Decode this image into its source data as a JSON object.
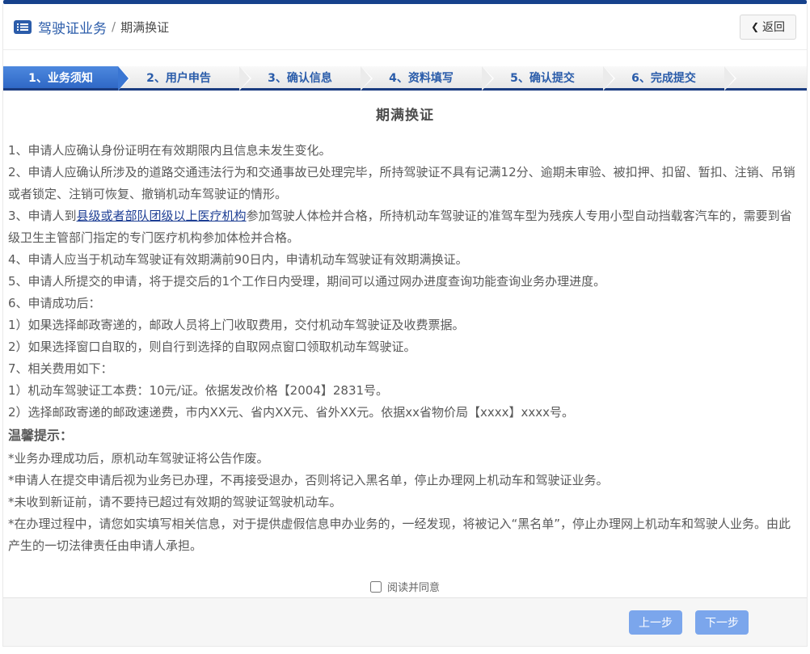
{
  "header": {
    "section_label": "驾驶证业务",
    "separator": "/",
    "current_page": "期满换证",
    "back_icon": "❮",
    "back_label": "返回"
  },
  "steps": [
    {
      "label": "1、业务须知",
      "active": true
    },
    {
      "label": "2、用户申告",
      "active": false
    },
    {
      "label": "3、确认信息",
      "active": false
    },
    {
      "label": "4、资料填写",
      "active": false
    },
    {
      "label": "5、确认提交",
      "active": false
    },
    {
      "label": "6、完成提交",
      "active": false
    }
  ],
  "content": {
    "title": "期满换证",
    "line1": "1、申请人应确认身份证明在有效期限内且信息未发生变化。",
    "line2": "2、申请人应确认所涉及的道路交通违法行为和交通事故已处理完毕，所持驾驶证不具有记满12分、逾期未审验、被扣押、扣留、暂扣、注销、吊销或者锁定、注销可恢复、撤销机动车驾驶证的情形。",
    "line3": {
      "prefix": "3、申请人到",
      "link": "县级或者部队团级以上医疗机构",
      "suffix": "参加驾驶人体检并合格，所持机动车驾驶证的准驾车型为残疾人专用小型自动挡载客汽车的，需要到省级卫生主管部门指定的专门医疗机构参加体检并合格。"
    },
    "line4": "4、申请人应当于机动车驾驶证有效期满前90日内，申请机动车驾驶证有效期满换证。",
    "line5": "5、申请人所提交的申请，将于提交后的1个工作日内受理，期间可以通过网办进度查询功能查询业务办理进度。",
    "line6": "6、申请成功后：",
    "line6_1": "1）如果选择邮政寄递的，邮政人员将上门收取费用，交付机动车驾驶证及收费票据。",
    "line6_2": "2）如果选择窗口自取的，则自行到选择的自取网点窗口领取机动车驾驶证。",
    "line7": "7、相关费用如下：",
    "line7_1": "1）机动车驾驶证工本费：10元/证。依据发改价格【2004】2831号。",
    "line7_2": "2）选择邮政寄递的邮政速递费，市内XX元、省内XX元、省外XX元。依据xx省物价局【xxxx】xxxx号。",
    "tips_heading": "温馨提示：",
    "tip1": "*业务办理成功后，原机动车驾驶证将公告作废。",
    "tip2": "*申请人在提交申请后视为业务已办理，不再接受退办，否则将记入黑名单，停止办理网上机动车和驾驶证业务。",
    "tip3": "*未收到新证前，请不要持已超过有效期的驾驶证驾驶机动车。",
    "tip4": "*在办理过程中，请您如实填写相关信息，对于提供虚假信息申办业务的，一经发现，将被记入“黑名单”，停止办理网上机动车和驾驶人业务。由此产生的一切法律责任由申请人承担。"
  },
  "agree": {
    "label": "阅读并同意",
    "checked": false
  },
  "footer": {
    "prev_label": "上一步",
    "next_label": "下一步"
  },
  "colors": {
    "topbar_navy": "#16418c",
    "steps_underline_navy": "#1b3c80",
    "active_step_blue": "#3a76d3",
    "breadcrumb_blue": "#2b5caa",
    "button_blue": "#7ba6ec",
    "link_navy": "#1d3e94"
  }
}
